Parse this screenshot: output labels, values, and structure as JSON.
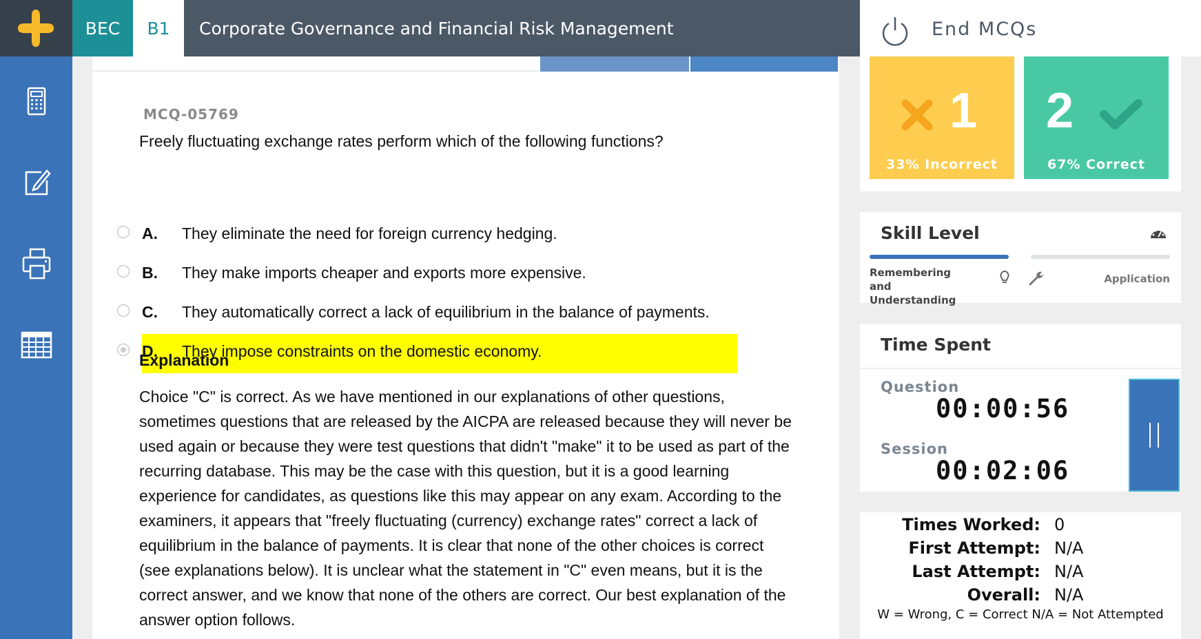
{
  "header": {
    "tabs": [
      {
        "label": "BEC"
      },
      {
        "label": "B1"
      }
    ],
    "course_title": "Corporate Governance and Financial Risk Management",
    "end_label": "End MCQs"
  },
  "sidebar": {
    "items": [
      {
        "icon": "calculator-icon"
      },
      {
        "icon": "edit-note-icon"
      },
      {
        "icon": "print-icon"
      },
      {
        "icon": "spreadsheet-icon"
      }
    ]
  },
  "question": {
    "id": "MCQ-05769",
    "text": "Freely fluctuating exchange rates perform which of the following functions?",
    "options": [
      {
        "letter": "A.",
        "text": "They eliminate the need for foreign currency hedging."
      },
      {
        "letter": "B.",
        "text": "They make imports cheaper and exports more expensive."
      },
      {
        "letter": "C.",
        "text": "They automatically correct a lack of equilibrium in the balance of payments."
      },
      {
        "letter": "D.",
        "text": "They impose constraints on the domestic economy."
      }
    ],
    "selected_option": "D.",
    "highlight_color": "#ffff00"
  },
  "explanation": {
    "title": "Explanation",
    "body": "Choice \"C\" is correct. As we have mentioned in our explanations of other questions, sometimes questions that are released by the AICPA are released because they will never be used again or because they were test questions that didn't \"make\" it to be used as part of the recurring database. This may be the case with this question, but it is a good learning experience for candidates, as questions like this may appear on any exam. According to the examiners, it appears that \"freely fluctuating (currency) exchange rates\" correct a lack of equilibrium in the balance of payments. It is clear that none of the other choices is correct (see explanations below). It is unclear what the statement in \"C\" even means, but it is the correct answer, and we know that none of the others are correct. Our best explanation of the answer option follows."
  },
  "score": {
    "incorrect_count": "1",
    "incorrect_label": "33% Incorrect",
    "correct_count": "2",
    "correct_label": "67% Correct",
    "incorrect_color": "#fecd4f",
    "correct_color": "#48c9a4"
  },
  "skill": {
    "title": "Skill Level",
    "level_a": "Remembering and Understanding",
    "level_b": "Application"
  },
  "time": {
    "title": "Time Spent",
    "question_label": "Question",
    "question_value": "00:00:56",
    "session_label": "Session",
    "session_value": "00:02:06"
  },
  "stats": {
    "rows": [
      {
        "key": "Times Worked:",
        "value": "0"
      },
      {
        "key": "First Attempt:",
        "value": "N/A"
      },
      {
        "key": "Last Attempt:",
        "value": "N/A"
      },
      {
        "key": "Overall:",
        "value": "N/A"
      }
    ],
    "legend": "W = Wrong, C = Correct N/A = Not Attempted"
  },
  "colors": {
    "accent_blue": "#3b73b9",
    "teal": "#1d8f97",
    "header_bg": "#4b5866"
  }
}
